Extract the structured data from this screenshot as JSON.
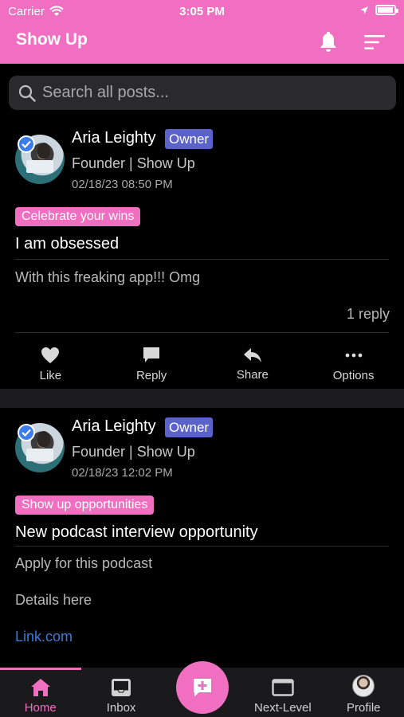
{
  "status_bar": {
    "carrier": "Carrier",
    "time": "3:05 PM",
    "battery_level": 0.95
  },
  "header": {
    "title": "Show Up",
    "bell_icon": "bell-icon",
    "filter_icon": "filter-icon"
  },
  "search": {
    "placeholder": "Search all posts..."
  },
  "posts": [
    {
      "author": "Aria Leighty",
      "badge": "Owner",
      "role": "Founder | Show Up",
      "timestamp": "02/18/23 08:50 PM",
      "category": "Celebrate your wins",
      "title": "I am obsessed",
      "body": "With this freaking app!!! Omg",
      "reply_count": "1 reply",
      "actions": [
        "Like",
        "Reply",
        "Share",
        "Options"
      ]
    },
    {
      "author": "Aria Leighty",
      "badge": "Owner",
      "role": "Founder | Show Up",
      "timestamp": "02/18/23 12:02 PM",
      "category": "Show up opportunities",
      "title": "New podcast interview opportunity",
      "body_lines": [
        "Apply for this podcast",
        "Details here"
      ],
      "link": "Link.com"
    }
  ],
  "bottom_nav": {
    "items": [
      {
        "label": "Home",
        "icon": "home-icon",
        "active": true
      },
      {
        "label": "Inbox",
        "icon": "inbox-icon"
      },
      {
        "label": "Next-Level",
        "icon": "screen-icon"
      },
      {
        "label": "Profile",
        "icon": "avatar"
      }
    ],
    "fab_icon": "new-post-icon"
  },
  "colors": {
    "accent": "#f06fc0",
    "owner_badge": "#5b62c9",
    "link": "#3a7bd5",
    "background": "#000000"
  }
}
